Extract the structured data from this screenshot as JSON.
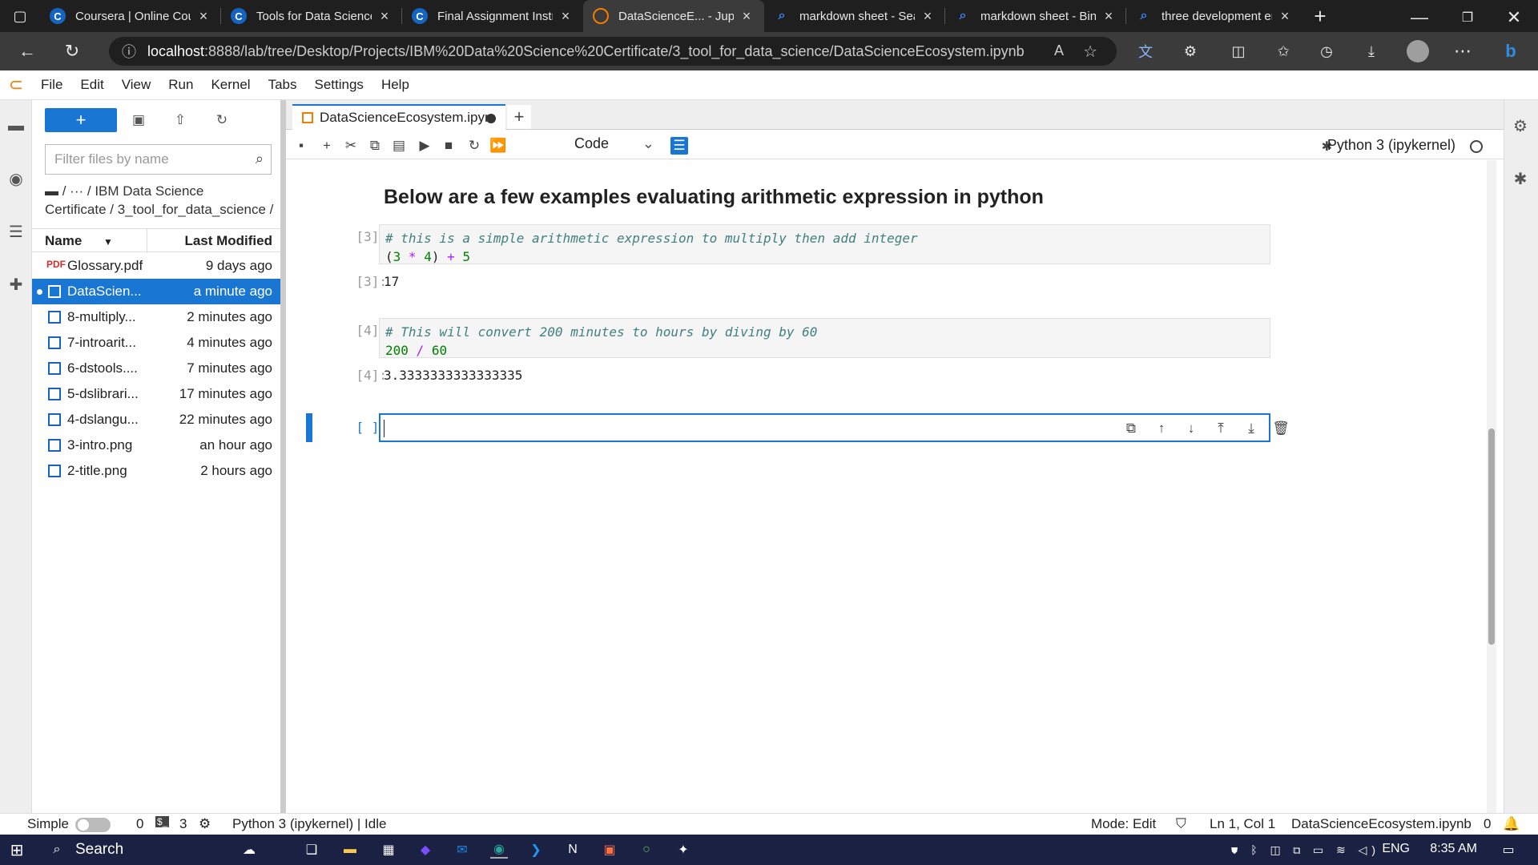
{
  "browser": {
    "tabs": [
      {
        "title": "Coursera | Online Cou",
        "icon": "coursera-icon",
        "color": "#1565c0"
      },
      {
        "title": "Tools for Data Science",
        "icon": "coursera-icon",
        "color": "#1565c0"
      },
      {
        "title": "Final Assignment Instr",
        "icon": "coursera-icon",
        "color": "#1565c0"
      },
      {
        "title": "DataScienceE... - Jupy",
        "icon": "jupyter-icon",
        "color": "#f57c00",
        "active": true
      },
      {
        "title": "markdown sheet - Sea",
        "icon": "search-icon",
        "color": "#3b82f6"
      },
      {
        "title": "markdown sheet - Bin",
        "icon": "search-icon",
        "color": "#3b82f6"
      },
      {
        "title": "three development en",
        "icon": "search-icon",
        "color": "#3b82f6"
      }
    ],
    "url_host": "localhost",
    "url_path": ":8888/lab/tree/Desktop/Projects/IBM%20Data%20Science%20Certificate/3_tool_for_data_science/DataScienceEcosystem.ipynb"
  },
  "menu": [
    "File",
    "Edit",
    "View",
    "Run",
    "Kernel",
    "Tabs",
    "Settings",
    "Help"
  ],
  "filebrowser": {
    "new_label": "+",
    "filter_placeholder": "Filter files by name",
    "breadcrumb_line1": "/ ··· / IBM Data Science",
    "breadcrumb_line2": "Certificate / 3_tool_for_data_science /",
    "col_name": "Name",
    "col_modified": "Last Modified",
    "files": [
      {
        "name": "Glossary.pdf",
        "modified": "9 days ago",
        "type": "pdf"
      },
      {
        "name": "DataScien...",
        "modified": "a minute ago",
        "type": "notebook",
        "selected": true
      },
      {
        "name": "8-multiply...",
        "modified": "2 minutes ago",
        "type": "image"
      },
      {
        "name": "7-introarit...",
        "modified": "4 minutes ago",
        "type": "image"
      },
      {
        "name": "6-dstools....",
        "modified": "7 minutes ago",
        "type": "image"
      },
      {
        "name": "5-dslibrari...",
        "modified": "17 minutes ago",
        "type": "image"
      },
      {
        "name": "4-dslangu...",
        "modified": "22 minutes ago",
        "type": "image"
      },
      {
        "name": "3-intro.png",
        "modified": "an hour ago",
        "type": "image"
      },
      {
        "name": "2-title.png",
        "modified": "2 hours ago",
        "type": "image"
      }
    ]
  },
  "notebook": {
    "tab_title": "DataScienceEcosystem.ipyn",
    "cell_type": "Code",
    "kernel": "Python 3 (ipykernel)",
    "heading": "Below are a few examples evaluating arithmetic expression in python",
    "cells": [
      {
        "prompt": "[3]:",
        "comment": "# this is a simple arithmetic expression to multiply then add integer",
        "output_prompt": "[3]:",
        "output": "17"
      },
      {
        "prompt": "[4]:",
        "comment": "# This will convert 200 minutes to hours by diving by 60",
        "output_prompt": "[4]:",
        "output": "3.3333333333333335"
      }
    ],
    "empty_prompt": "[ ]:"
  },
  "statusbar": {
    "mode_label": "Simple",
    "count1": "0",
    "count2": "3",
    "kernel_status": "Python 3 (ipykernel) | Idle",
    "mode": "Mode: Edit",
    "position": "Ln 1, Col 1",
    "filename": "DataScienceEcosystem.ipynb",
    "notifications": "0"
  },
  "taskbar": {
    "search": "Search",
    "lang": "ENG",
    "time": "8:35 AM"
  }
}
